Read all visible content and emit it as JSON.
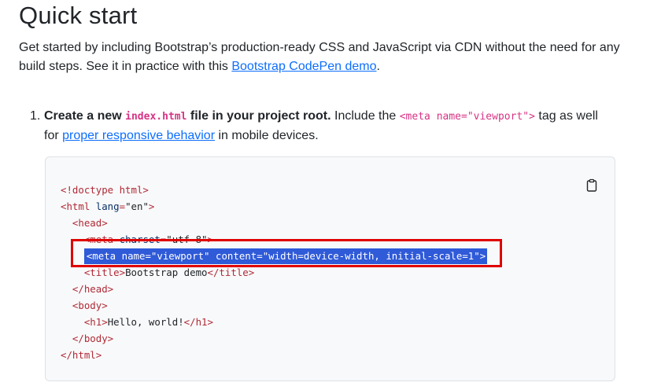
{
  "page": {
    "title": "Quick start",
    "intro_text_1": "Get started by including Bootstrap’s production-ready CSS and JavaScript via CDN without the need for any build steps. See it in practice with this ",
    "intro_link": "Bootstrap CodePen demo",
    "intro_text_2": "."
  },
  "step1": {
    "number": "1.",
    "bold_1": "Create a new ",
    "code_file": "index.html",
    "bold_2": " file in your project root.",
    "text_1": " Include the ",
    "code_meta": "<meta name=\"viewport\">",
    "text_2": " tag as well",
    "text_3": "for ",
    "link": "proper responsive behavior",
    "text_4": " in mobile devices."
  },
  "code": {
    "lines": [
      "<!doctype html>",
      "<html lang=\"en\">",
      "  <head>",
      "    <meta charset=\"utf-8\">",
      "    <meta name=\"viewport\" content=\"width=device-width, initial-scale=1\">",
      "    <title>Bootstrap demo</title>",
      "  </head>",
      "  <body>",
      "    <h1>Hello, world!</h1>",
      "  </body>",
      "</html>"
    ],
    "highlighted_line_index": 4
  },
  "icons": {
    "copy": "clipboard-icon"
  },
  "colors": {
    "link": "#0d6efd",
    "code_inline": "#d63384",
    "highlight": "#2f5ad8",
    "annotation": "#e00000"
  }
}
